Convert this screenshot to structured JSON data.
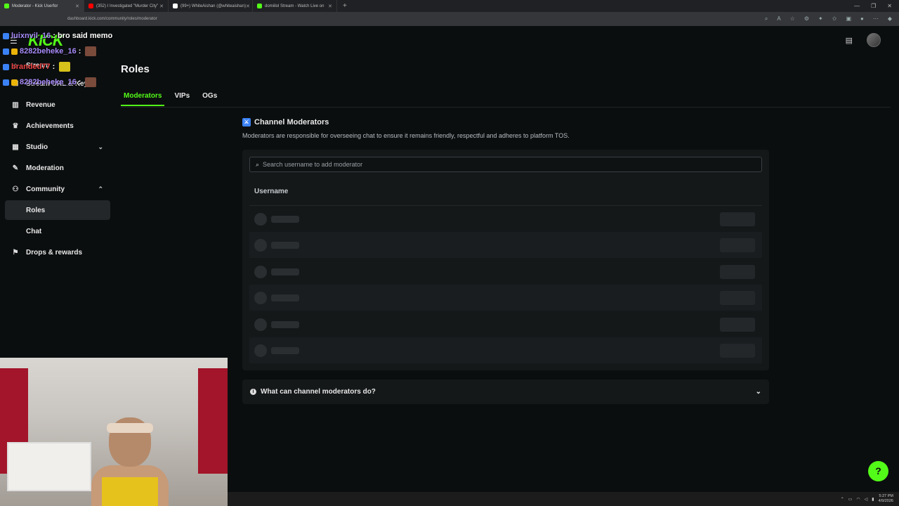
{
  "browser": {
    "tabs": [
      {
        "label": "Moderator - Kick Userfor",
        "color": "#53fc18",
        "active": true
      },
      {
        "label": "(352) I Investigated \"Murder City\"",
        "color": "#ff0000",
        "active": false
      },
      {
        "label": "(99+) WhiteAishan (@whiteaishan)",
        "color": "#ffffff",
        "active": false
      },
      {
        "label": "domiilol Stream - Watch Live on",
        "color": "#53fc18",
        "active": false
      }
    ],
    "new_tab": "+",
    "url": "dashboard.kick.com/community/roles/moderator"
  },
  "header": {
    "logo": "KICK"
  },
  "chat_overlay": [
    {
      "user": "luixnvil_16",
      "msg": ": bro said memo"
    },
    {
      "user": "8282beheke_16",
      "msg": ":"
    },
    {
      "user": "branded77",
      "msg": ":"
    },
    {
      "user": "8282beheke_16",
      "msg": ":"
    }
  ],
  "sidebar": {
    "items": [
      {
        "label": "Stream",
        "icon": "home-icon"
      },
      {
        "label": "Stream URL & Key",
        "icon": "key-icon"
      },
      {
        "label": "Revenue",
        "icon": "chart-icon"
      },
      {
        "label": "Achievements",
        "icon": "trophy-icon"
      },
      {
        "label": "Studio",
        "icon": "studio-icon"
      },
      {
        "label": "Moderation",
        "icon": "wrench-icon"
      },
      {
        "label": "Community",
        "icon": "community-icon"
      },
      {
        "label": "Roles",
        "icon": ""
      },
      {
        "label": "Chat",
        "icon": ""
      },
      {
        "label": "Drops & rewards",
        "icon": "gift-icon"
      }
    ]
  },
  "main": {
    "title": "Roles",
    "tabs": [
      "Moderators",
      "VIPs",
      "OGs"
    ],
    "section_title": "Channel Moderators",
    "section_desc": "Moderators are responsible for overseeing chat to ensure it remains friendly, respectful and adheres to platform TOS.",
    "search_placeholder": "Search username to add moderator",
    "column_header": "Username",
    "faq_label": "What can channel moderators do?"
  },
  "taskbar": {
    "time": "5:27 PM",
    "date": "4/9/2026"
  },
  "colors": {
    "accent": "#53fc18",
    "background": "#0b0e0f",
    "card": "#151819"
  }
}
